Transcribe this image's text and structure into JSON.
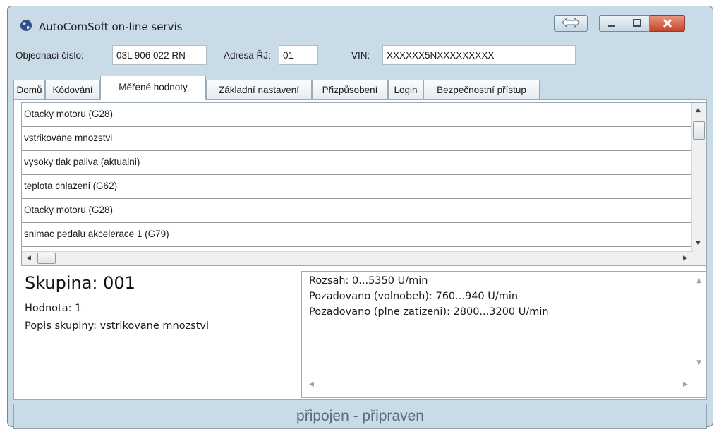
{
  "window": {
    "title": "AutoComSoft on-line servis"
  },
  "info": {
    "order_label": "Objednací číslo:",
    "order_value": "03L 906 022 RN",
    "address_label": "Adresa ŘJ:",
    "address_value": "01",
    "vin_label": "VIN:",
    "vin_value": "XXXXXX5NXXXXXXXXX"
  },
  "tabs": [
    {
      "label": "Domů"
    },
    {
      "label": "Kódování"
    },
    {
      "label": "Měřené hodnoty"
    },
    {
      "label": "Základní nastavení"
    },
    {
      "label": "Přizpůsobení"
    },
    {
      "label": "Login"
    },
    {
      "label": "Bezpečnostní přístup"
    }
  ],
  "active_tab": "Měřené hodnoty",
  "list": {
    "items": [
      "Otacky motoru (G28)",
      "vstrikovane mnozstvi",
      "vysoky tlak paliva (aktualni)",
      "teplota chlazeni (G62)",
      "Otacky motoru (G28)",
      "snimac pedalu akcelerace 1 (G79)"
    ],
    "selected_index": 0
  },
  "group": {
    "title": "Skupina: 001",
    "value_line": "Hodnota: 1",
    "description_line": "Popis skupiny: vstrikovane mnozstvi"
  },
  "details": {
    "lines": [
      "Rozsah: 0...5350 U/min",
      "Pozadovano (volnobeh): 760...940 U/min",
      "Pozadovano (plne zatizeni): 2800...3200 U/min"
    ]
  },
  "status": {
    "text": "připojen - připraven"
  },
  "colors": {
    "window_bg": "#c9dbe6",
    "close_button": "#c4452b",
    "status_text": "#5b6c78"
  },
  "icons": {
    "app": "globe-icon",
    "swap": "double-arrow-icon",
    "minimize": "minimize-icon",
    "maximize": "maximize-icon",
    "close": "close-icon"
  }
}
